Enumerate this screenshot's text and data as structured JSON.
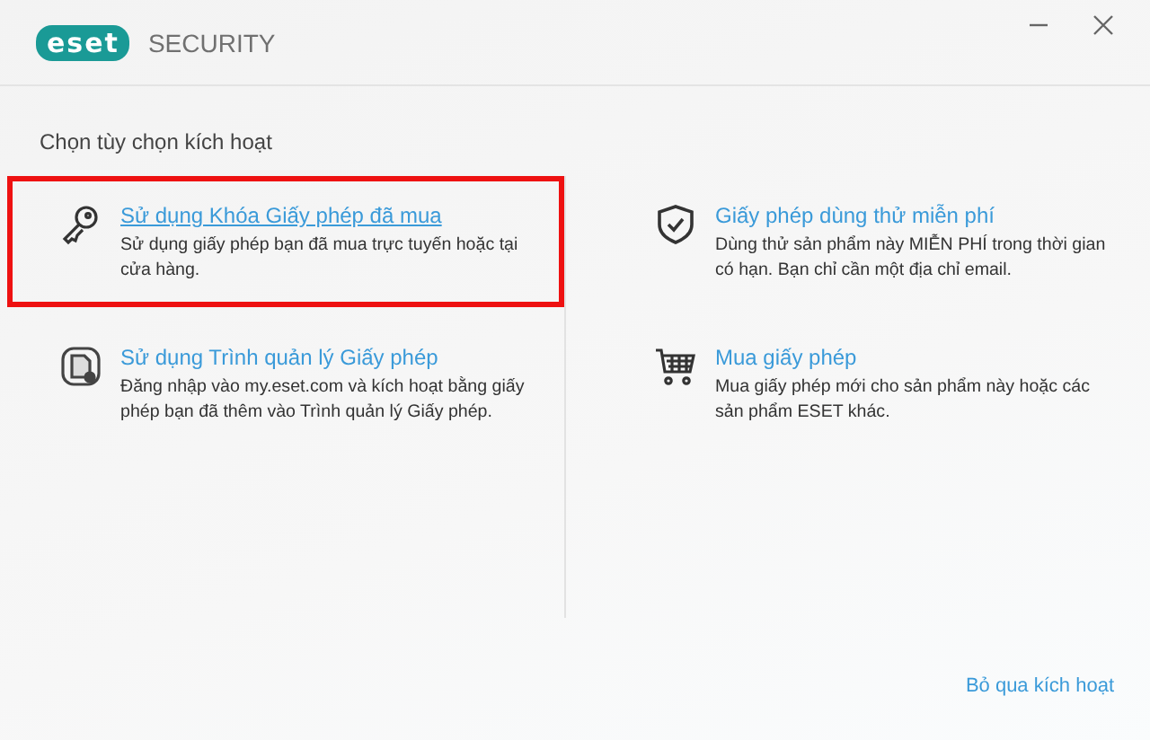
{
  "window": {
    "brand": "eset",
    "title": "SECURITY"
  },
  "heading": "Chọn tùy chọn kích hoạt",
  "columns": [
    [
      {
        "kind": "key",
        "title": "Sử dụng Khóa Giấy phép đã mua",
        "description": "Sử dụng giấy phép bạn đã mua trực tuyến hoặc tại cửa hàng.",
        "highlighted": true,
        "underlined": true
      },
      {
        "kind": "manager",
        "title": "Sử dụng Trình quản lý Giấy phép",
        "description": "Đăng nhập vào my.eset.com và kích hoạt bằng giấy phép bạn đã thêm vào Trình quản lý Giấy phép.",
        "highlighted": false,
        "underlined": false
      }
    ],
    [
      {
        "kind": "shield",
        "title": "Giấy phép dùng thử miễn phí",
        "description": "Dùng thử sản phẩm này MIỄN PHÍ trong thời gian có hạn. Bạn chỉ cần một địa chỉ email.",
        "highlighted": false,
        "underlined": false
      },
      {
        "kind": "cart",
        "title": "Mua giấy phép",
        "description": "Mua giấy phép mới cho sản phẩm này hoặc các sản phẩm ESET khác.",
        "highlighted": false,
        "underlined": false
      }
    ]
  ],
  "skip_link": "Bỏ qua kích hoạt"
}
